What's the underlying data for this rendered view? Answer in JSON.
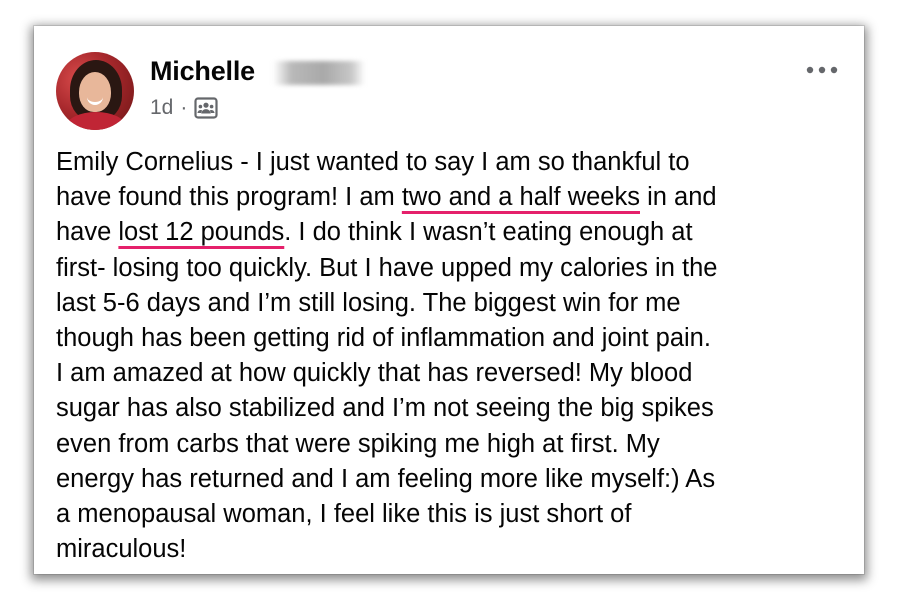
{
  "post": {
    "author": "Michelle",
    "timestamp": "1d",
    "separator": "·",
    "audience_icon": "group-icon",
    "more_icon": "more-options-icon",
    "accent_color": "#e5206b",
    "body_lines": [
      {
        "pre": "Emily Cornelius - I just wanted to say I am so thankful to",
        "hl": "",
        "post": ""
      },
      {
        "pre": "have found this program! I am ",
        "hl": "two and a half weeks",
        "post": " in and"
      },
      {
        "pre": "have ",
        "hl": "lost 12 pounds",
        "post": ". I do think I wasn’t eating enough at"
      },
      {
        "pre": "first- losing too quickly. But I have upped my calories in the",
        "hl": "",
        "post": ""
      },
      {
        "pre": "last 5-6 days and I’m still losing. The biggest win for me",
        "hl": "",
        "post": ""
      },
      {
        "pre": "though has been getting rid of inflammation and joint pain.",
        "hl": "",
        "post": ""
      },
      {
        "pre": "I am amazed at how quickly that has reversed! My blood",
        "hl": "",
        "post": ""
      },
      {
        "pre": "sugar has also stabilized and I’m not seeing the big spikes",
        "hl": "",
        "post": ""
      },
      {
        "pre": "even from carbs that were spiking me high at first. My",
        "hl": "",
        "post": ""
      },
      {
        "pre": "energy has returned and I am feeling more like myself:) As",
        "hl": "",
        "post": ""
      },
      {
        "pre": "a menopausal woman, I feel like this is just short of",
        "hl": "",
        "post": ""
      },
      {
        "pre": "miraculous!",
        "hl": "",
        "post": ""
      }
    ]
  }
}
